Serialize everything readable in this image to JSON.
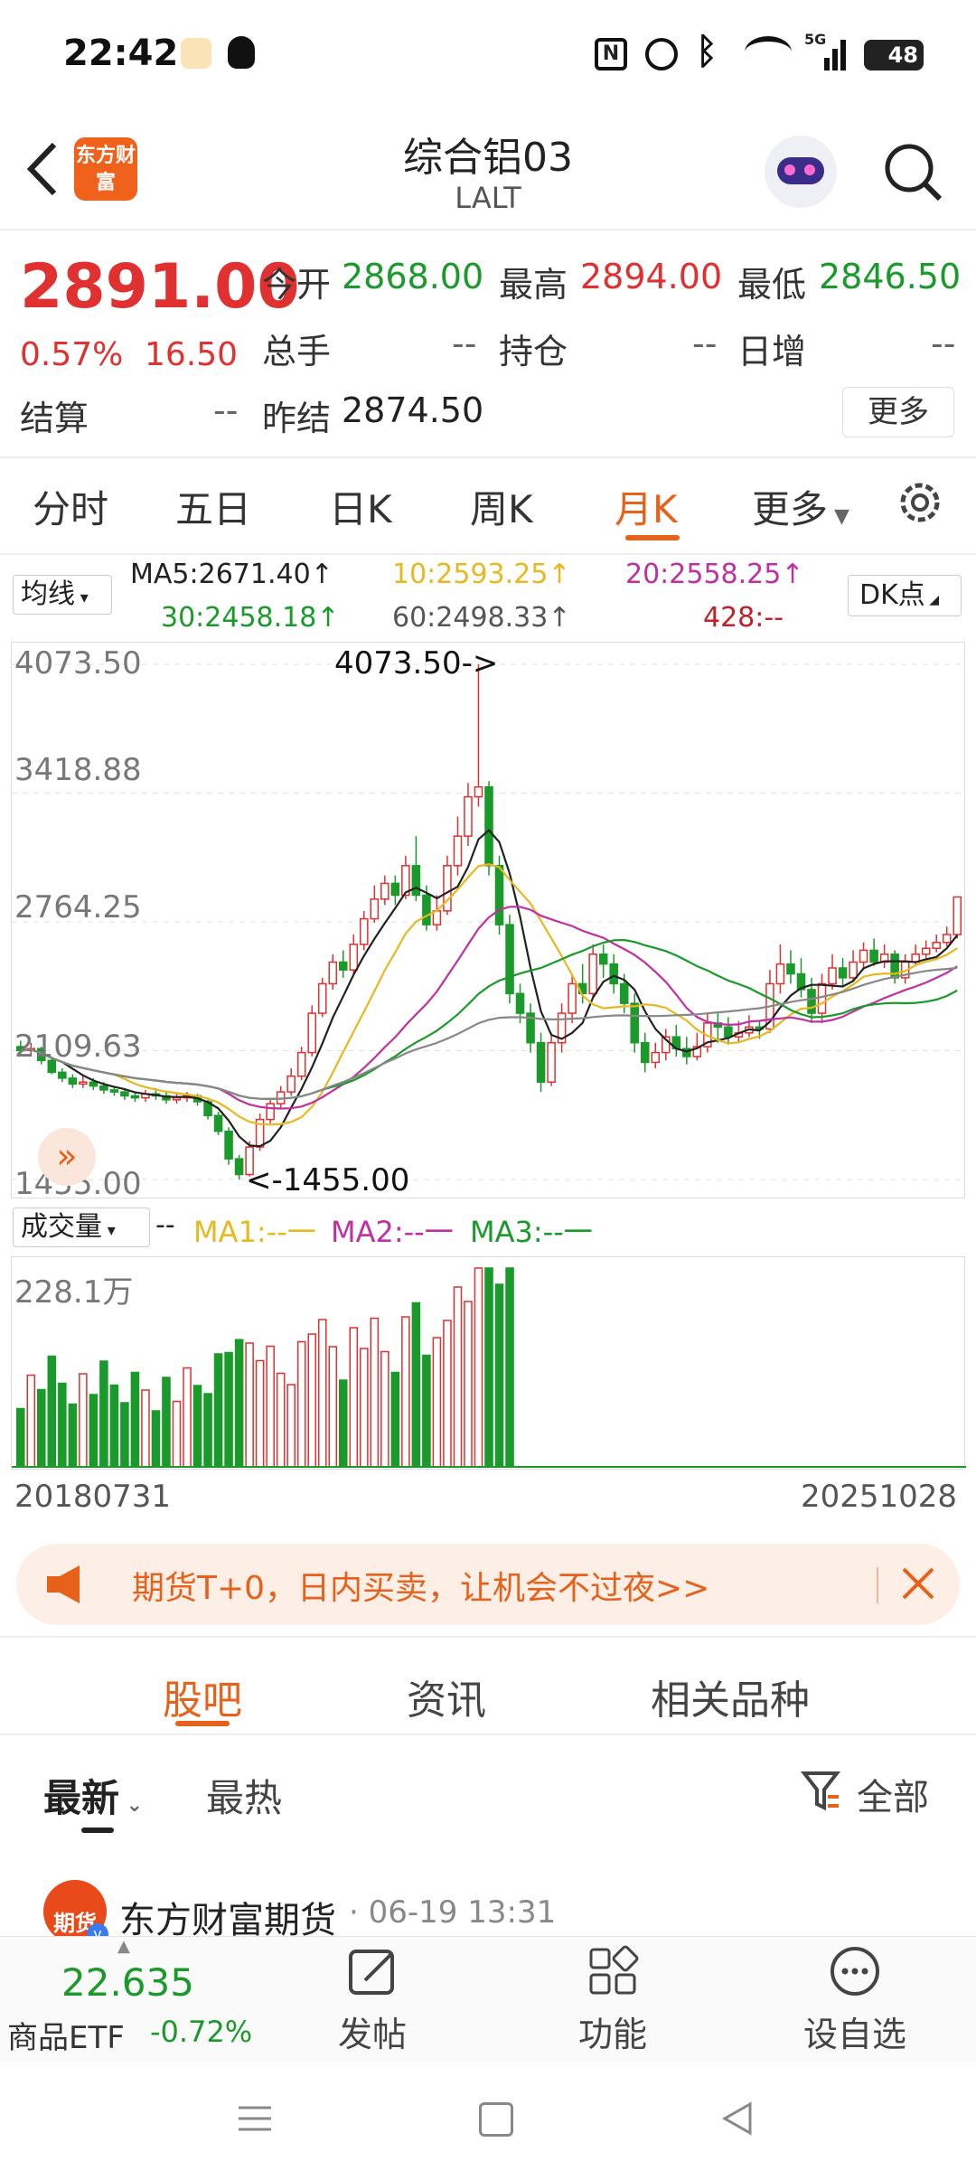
{
  "status_bar": {
    "time": "22:42",
    "battery": "48",
    "signal": "5G"
  },
  "header": {
    "title": "综合铝03",
    "subtitle": "LALT",
    "logo_text": "东方财富"
  },
  "quote": {
    "price": "2891.00",
    "change_pct": "0.57%",
    "change": "16.50",
    "fields": [
      {
        "label": "今开",
        "value": "2868.00",
        "color": "green"
      },
      {
        "label": "最高",
        "value": "2894.00",
        "color": "red"
      },
      {
        "label": "最低",
        "value": "2846.50",
        "color": "green"
      },
      {
        "label": "总手",
        "value": "--",
        "color": "gray"
      },
      {
        "label": "持仓",
        "value": "--",
        "color": "gray"
      },
      {
        "label": "日增",
        "value": "--",
        "color": "gray"
      },
      {
        "label": "结算",
        "value": "--",
        "color": "gray"
      },
      {
        "label": "昨结",
        "value": "2874.50",
        "color": "dark"
      }
    ],
    "more_button": "更多"
  },
  "period_tabs": [
    "分时",
    "五日",
    "日K",
    "周K",
    "月K",
    "更多"
  ],
  "active_period": "月K",
  "ma_row": {
    "selector": "均线",
    "ma5": "MA5:2671.40↑",
    "ma10": "10:2593.25↑",
    "ma20": "20:2558.25↑",
    "ma30": "30:2458.18↑",
    "ma60": "60:2498.33↑",
    "ma428": "428:--",
    "dk_button": "DK点"
  },
  "price_axis": [
    "4073.50",
    "3418.88",
    "2764.25",
    "2109.63",
    "1455.00"
  ],
  "annotations": {
    "high": "4073.50->",
    "low": "<-1455.00"
  },
  "volume_row": {
    "selector": "成交量",
    "dash": "--",
    "ma1": "MA1:--一",
    "ma2": "MA2:--一",
    "ma3": "MA3:--一",
    "max_label": "228.1万"
  },
  "date_range": {
    "start": "20180731",
    "end": "20251028"
  },
  "banner": {
    "text": "期货T+0，日内买卖，让机会不过夜>>"
  },
  "community_tabs": [
    "股吧",
    "资讯",
    "相关品种"
  ],
  "feed_tabs": {
    "latest": "最新",
    "hot": "最热",
    "filter": "全部"
  },
  "post": {
    "author": "东方财富期货",
    "time": "· 06-19 13:31",
    "avatar_text": "期货"
  },
  "bottom_bar": {
    "etf_price": "22.635",
    "etf_name": "商品ETF",
    "etf_change": "-0.72%",
    "post": "发帖",
    "func": "功能",
    "watch": "设自选"
  },
  "colors": {
    "up": "#e03030",
    "down": "#1a9a2a",
    "accent": "#e8611a",
    "ma5": "#222222",
    "ma10": "#e8b820",
    "ma20": "#c030a0",
    "ma30": "#1a9a2a",
    "ma60": "#888888"
  },
  "chart_data": {
    "type": "candlestick",
    "period": "monthly",
    "ylim": [
      1455.0,
      4073.5
    ],
    "candles": [
      [
        2130,
        2110,
        2160,
        2090
      ],
      [
        2110,
        2120,
        2150,
        2080
      ],
      [
        2120,
        2060,
        2130,
        2040
      ],
      [
        2060,
        2000,
        2080,
        1990
      ],
      [
        2000,
        1970,
        2020,
        1950
      ],
      [
        1970,
        1940,
        1990,
        1920
      ],
      [
        1940,
        1950,
        1980,
        1920
      ],
      [
        1950,
        1930,
        1970,
        1910
      ],
      [
        1930,
        1910,
        1950,
        1890
      ],
      [
        1910,
        1900,
        1930,
        1880
      ],
      [
        1900,
        1880,
        1920,
        1860
      ],
      [
        1880,
        1870,
        1900,
        1850
      ],
      [
        1870,
        1890,
        1910,
        1850
      ],
      [
        1890,
        1880,
        1920,
        1860
      ],
      [
        1880,
        1860,
        1900,
        1840
      ],
      [
        1860,
        1870,
        1890,
        1840
      ],
      [
        1870,
        1880,
        1900,
        1850
      ],
      [
        1880,
        1850,
        1890,
        1830
      ],
      [
        1850,
        1780,
        1860,
        1760
      ],
      [
        1780,
        1700,
        1800,
        1680
      ],
      [
        1700,
        1560,
        1720,
        1530
      ],
      [
        1560,
        1480,
        1580,
        1455
      ],
      [
        1480,
        1620,
        1650,
        1470
      ],
      [
        1620,
        1760,
        1790,
        1600
      ],
      [
        1760,
        1840,
        1870,
        1740
      ],
      [
        1840,
        1900,
        1930,
        1820
      ],
      [
        1900,
        1980,
        2020,
        1880
      ],
      [
        1980,
        2100,
        2130,
        1960
      ],
      [
        2100,
        2300,
        2340,
        2080
      ],
      [
        2300,
        2450,
        2480,
        2280
      ],
      [
        2450,
        2560,
        2600,
        2420
      ],
      [
        2560,
        2520,
        2620,
        2480
      ],
      [
        2520,
        2650,
        2700,
        2500
      ],
      [
        2650,
        2780,
        2820,
        2620
      ],
      [
        2780,
        2880,
        2950,
        2760
      ],
      [
        2880,
        2960,
        3000,
        2850
      ],
      [
        2960,
        2900,
        3000,
        2850
      ],
      [
        2900,
        3050,
        3100,
        2880
      ],
      [
        3050,
        2900,
        3200,
        2870
      ],
      [
        2900,
        2750,
        2950,
        2720
      ],
      [
        2750,
        2820,
        2900,
        2720
      ],
      [
        2820,
        3050,
        3100,
        2800
      ],
      [
        3050,
        3200,
        3300,
        3000
      ],
      [
        3200,
        3400,
        3470,
        3150
      ],
      [
        3400,
        3450,
        4073.5,
        3350
      ],
      [
        3450,
        3050,
        3480,
        3000
      ],
      [
        3050,
        2750,
        3100,
        2700
      ],
      [
        2750,
        2400,
        2800,
        2350
      ],
      [
        2400,
        2300,
        2450,
        2250
      ],
      [
        2300,
        2150,
        2350,
        2100
      ],
      [
        2150,
        1950,
        2200,
        1900
      ],
      [
        1950,
        2150,
        2200,
        1930
      ],
      [
        2150,
        2300,
        2350,
        2100
      ],
      [
        2300,
        2450,
        2500,
        2250
      ],
      [
        2450,
        2400,
        2550,
        2350
      ],
      [
        2400,
        2600,
        2650,
        2380
      ],
      [
        2600,
        2550,
        2650,
        2480
      ],
      [
        2550,
        2450,
        2600,
        2400
      ],
      [
        2450,
        2350,
        2500,
        2300
      ],
      [
        2350,
        2150,
        2400,
        2100
      ],
      [
        2150,
        2050,
        2200,
        2000
      ],
      [
        2050,
        2100,
        2150,
        2020
      ],
      [
        2100,
        2180,
        2220,
        2060
      ],
      [
        2180,
        2120,
        2240,
        2080
      ],
      [
        2120,
        2080,
        2180,
        2040
      ],
      [
        2080,
        2130,
        2200,
        2060
      ],
      [
        2130,
        2250,
        2300,
        2100
      ],
      [
        2250,
        2230,
        2300,
        2150
      ],
      [
        2230,
        2180,
        2280,
        2140
      ],
      [
        2180,
        2200,
        2260,
        2150
      ],
      [
        2200,
        2230,
        2290,
        2180
      ],
      [
        2230,
        2220,
        2260,
        2170
      ],
      [
        2220,
        2450,
        2520,
        2200
      ],
      [
        2450,
        2550,
        2650,
        2400
      ],
      [
        2550,
        2500,
        2620,
        2450
      ],
      [
        2500,
        2420,
        2580,
        2380
      ],
      [
        2420,
        2300,
        2480,
        2250
      ],
      [
        2300,
        2450,
        2500,
        2250
      ],
      [
        2450,
        2530,
        2600,
        2420
      ],
      [
        2530,
        2480,
        2580,
        2440
      ],
      [
        2480,
        2560,
        2620,
        2460
      ],
      [
        2560,
        2620,
        2660,
        2520
      ],
      [
        2620,
        2560,
        2680,
        2540
      ],
      [
        2560,
        2600,
        2650,
        2530
      ],
      [
        2600,
        2480,
        2620,
        2450
      ],
      [
        2480,
        2560,
        2600,
        2450
      ],
      [
        2560,
        2600,
        2650,
        2540
      ],
      [
        2600,
        2630,
        2670,
        2570
      ],
      [
        2630,
        2660,
        2700,
        2610
      ],
      [
        2660,
        2700,
        2740,
        2640
      ],
      [
        2700,
        2891,
        2894,
        2680
      ]
    ]
  }
}
